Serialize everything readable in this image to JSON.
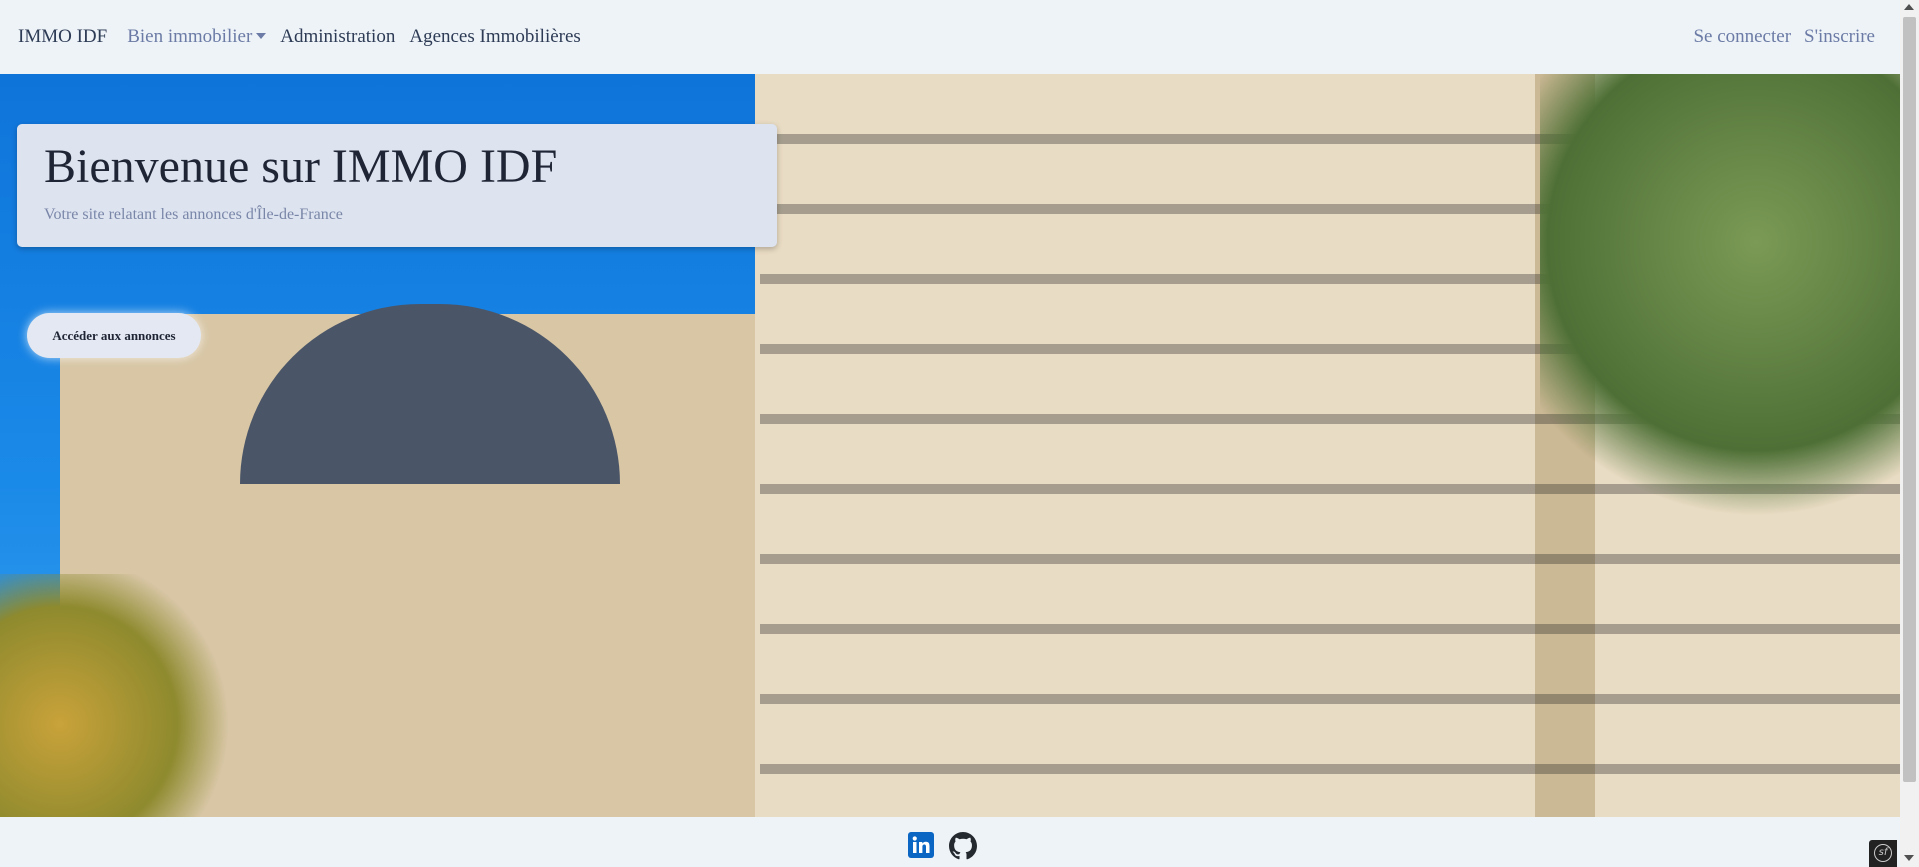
{
  "nav": {
    "brand": "IMMO IDF",
    "items": [
      {
        "label": "Bien immobilier"
      },
      {
        "label": "Administration"
      },
      {
        "label": "Agences Immobilières"
      }
    ],
    "right": [
      {
        "label": "Se connecter"
      },
      {
        "label": "S'inscrire"
      }
    ]
  },
  "hero": {
    "title": "Bienvenue sur IMMO IDF",
    "subtitle": "Votre site relatant les annonces d'Île-de-France",
    "cta_label": "Accéder aux annonces"
  },
  "footer": {
    "icons": [
      "linkedin-icon",
      "github-icon"
    ]
  },
  "colors": {
    "nav_bg": "#eef3f8",
    "linkedin": "#0a66c2",
    "jumbotron_bg": "#dde4f0"
  },
  "debug_toolbar": {
    "glyph": "sf"
  }
}
